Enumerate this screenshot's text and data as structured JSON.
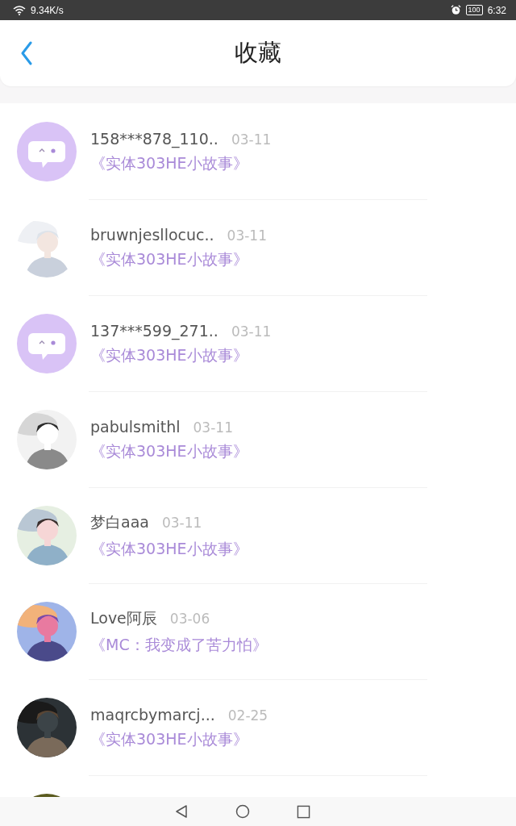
{
  "status_bar": {
    "speed": "9.34K/s",
    "battery": "100",
    "time": "6:32"
  },
  "header": {
    "title": "收藏"
  },
  "items": [
    {
      "avatar": {
        "kind": "default"
      },
      "name": "158***878_110..",
      "date": "03-11",
      "title": "《实体303HE小故事》"
    },
    {
      "avatar": {
        "kind": "picture"
      },
      "name": "bruwnjesllocuc..",
      "date": "03-11",
      "title": "《实体303HE小故事》"
    },
    {
      "avatar": {
        "kind": "default"
      },
      "name": "137***599_271..",
      "date": "03-11",
      "title": "《实体303HE小故事》"
    },
    {
      "avatar": {
        "kind": "picture"
      },
      "name": "pabulsmithl",
      "date": "03-11",
      "title": "《实体303HE小故事》"
    },
    {
      "avatar": {
        "kind": "picture"
      },
      "name": "梦白aaa",
      "date": "03-11",
      "title": "《实体303HE小故事》"
    },
    {
      "avatar": {
        "kind": "picture"
      },
      "name": "Love阿辰",
      "date": "03-06",
      "title": "《MC：我变成了苦力怕》"
    },
    {
      "avatar": {
        "kind": "picture"
      },
      "name": "maqrcbymarcj...",
      "date": "02-25",
      "title": "《实体303HE小故事》"
    },
    {
      "avatar": {
        "kind": "picture"
      }
    }
  ]
}
